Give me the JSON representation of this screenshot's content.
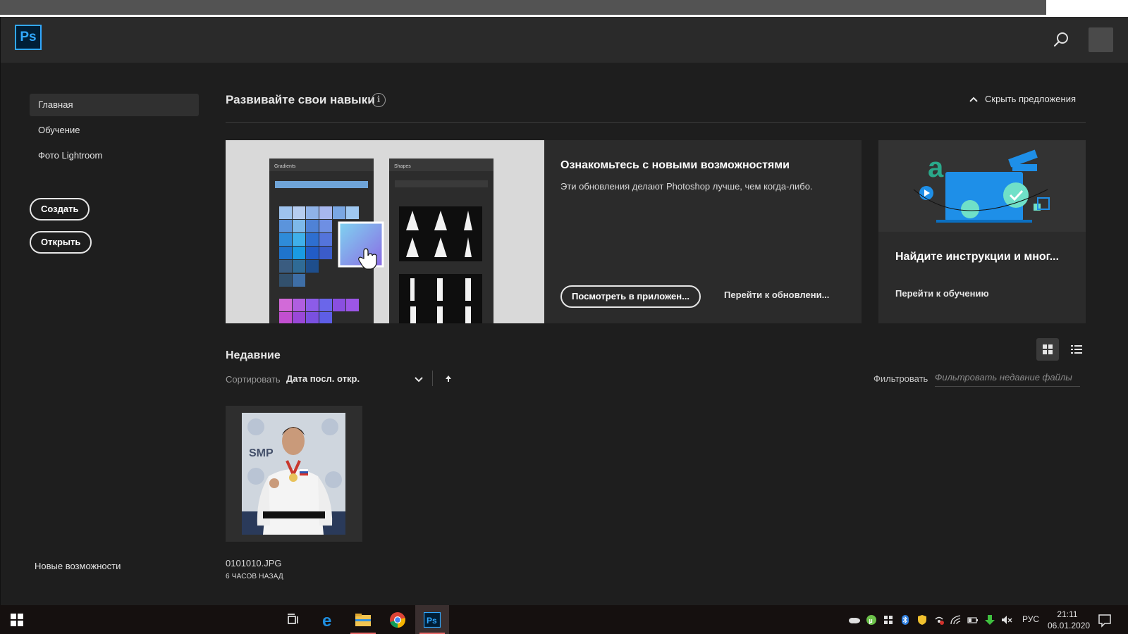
{
  "app": {
    "logo_text": "Ps"
  },
  "sidebar": {
    "items": [
      {
        "label": "Главная"
      },
      {
        "label": "Обучение"
      },
      {
        "label": "Фото Lightroom"
      }
    ],
    "create_label": "Создать",
    "open_label": "Открыть",
    "whats_new_label": "Новые возможности"
  },
  "skills": {
    "title": "Развивайте свои навыки",
    "hide_label": "Скрыть предложения"
  },
  "feature": {
    "title": "Ознакомьтесь с новыми возможностями",
    "subtitle": "Эти обновления делают Photoshop лучше, чем когда-либо.",
    "view_in_app_label": "Посмотреть в приложен...",
    "go_to_updates_label": "Перейти к обновлени...",
    "panel_left_title": "Gradients",
    "panel_right_title": "Shapes"
  },
  "tutorial": {
    "title": "Найдите инструкции и мног...",
    "link_label": "Перейти к обучению"
  },
  "recent": {
    "title": "Недавние",
    "sort_label": "Сортировать",
    "sort_value": "Дата посл. откр.",
    "filter_label": "Фильтровать",
    "filter_placeholder": "Фильтровать недавние файлы",
    "files": [
      {
        "name": "0101010.JPG",
        "time": "6 ЧАСОВ НАЗАД"
      }
    ]
  },
  "taskbar": {
    "language": "РУС",
    "time": "21:11",
    "date": "06.01.2020"
  },
  "colors": {
    "ps_blue": "#31a8ff",
    "ps_navy": "#001e36",
    "background": "#1e1e1e",
    "card": "#2b2b2b"
  }
}
